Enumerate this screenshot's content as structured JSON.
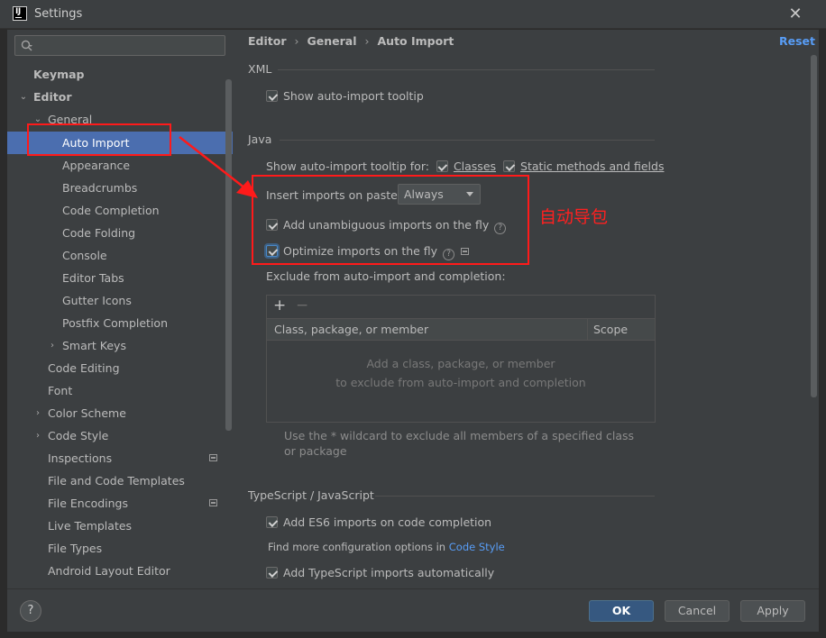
{
  "window": {
    "title": "Settings",
    "app_icon_text": "IJ"
  },
  "sidebar": {
    "search_value": "",
    "items": [
      {
        "label": "Keymap"
      },
      {
        "label": "Editor"
      },
      {
        "label": "General"
      },
      {
        "label": "Auto Import"
      },
      {
        "label": "Appearance"
      },
      {
        "label": "Breadcrumbs"
      },
      {
        "label": "Code Completion"
      },
      {
        "label": "Code Folding"
      },
      {
        "label": "Console"
      },
      {
        "label": "Editor Tabs"
      },
      {
        "label": "Gutter Icons"
      },
      {
        "label": "Postfix Completion"
      },
      {
        "label": "Smart Keys"
      },
      {
        "label": "Code Editing"
      },
      {
        "label": "Font"
      },
      {
        "label": "Color Scheme"
      },
      {
        "label": "Code Style"
      },
      {
        "label": "Inspections"
      },
      {
        "label": "File and Code Templates"
      },
      {
        "label": "File Encodings"
      },
      {
        "label": "Live Templates"
      },
      {
        "label": "File Types"
      },
      {
        "label": "Android Layout Editor"
      }
    ]
  },
  "breadcrumb": [
    "Editor",
    "General",
    "Auto Import"
  ],
  "reset_label": "Reset",
  "xml": {
    "title": "XML",
    "show_tooltip": "Show auto-import tooltip"
  },
  "java": {
    "title": "Java",
    "tooltip_for": "Show auto-import tooltip for:",
    "classes": "Classes",
    "static_methods": "Static methods and fields",
    "insert_on_paste": "Insert imports on paste:",
    "insert_on_paste_value": "Always",
    "add_unambiguous": "Add unambiguous imports on the fly",
    "optimize": "Optimize imports on the fly",
    "exclude_label": "Exclude from auto-import and completion:",
    "col_class": "Class, package, or member",
    "col_scope": "Scope",
    "empty_line1": "Add a class, package, or member",
    "empty_line2": "to exclude from auto-import and completion",
    "hint": "Use the * wildcard to exclude all members of a specified class or package"
  },
  "annotation": {
    "text": "自动导包",
    "color": "#ff2020"
  },
  "ts": {
    "title": "TypeScript / JavaScript",
    "add_es6": "Add ES6 imports on code completion",
    "more_config": "Find more configuration options in",
    "code_style_link": "Code Style",
    "add_ts": "Add TypeScript imports automatically"
  },
  "footer": {
    "help": "?",
    "ok": "OK",
    "cancel": "Cancel",
    "apply": "Apply"
  },
  "colors": {
    "accent": "#4b6eaf",
    "link": "#589df6",
    "background": "#3c3f41"
  }
}
